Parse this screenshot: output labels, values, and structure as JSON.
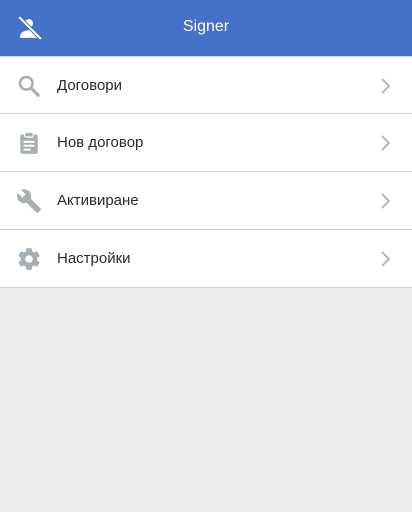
{
  "header": {
    "title": "Signer",
    "icon": "user-off-icon",
    "background": "#4472c9"
  },
  "menu": {
    "items": [
      {
        "label": "Договори",
        "icon": "search-icon"
      },
      {
        "label": "Нов договор",
        "icon": "clipboard-icon"
      },
      {
        "label": "Активиране",
        "icon": "wrench-icon"
      },
      {
        "label": "Настройки",
        "icon": "gear-icon"
      }
    ],
    "chevron_icon": "chevron-right-icon",
    "icon_color": "#a7aeb4"
  }
}
